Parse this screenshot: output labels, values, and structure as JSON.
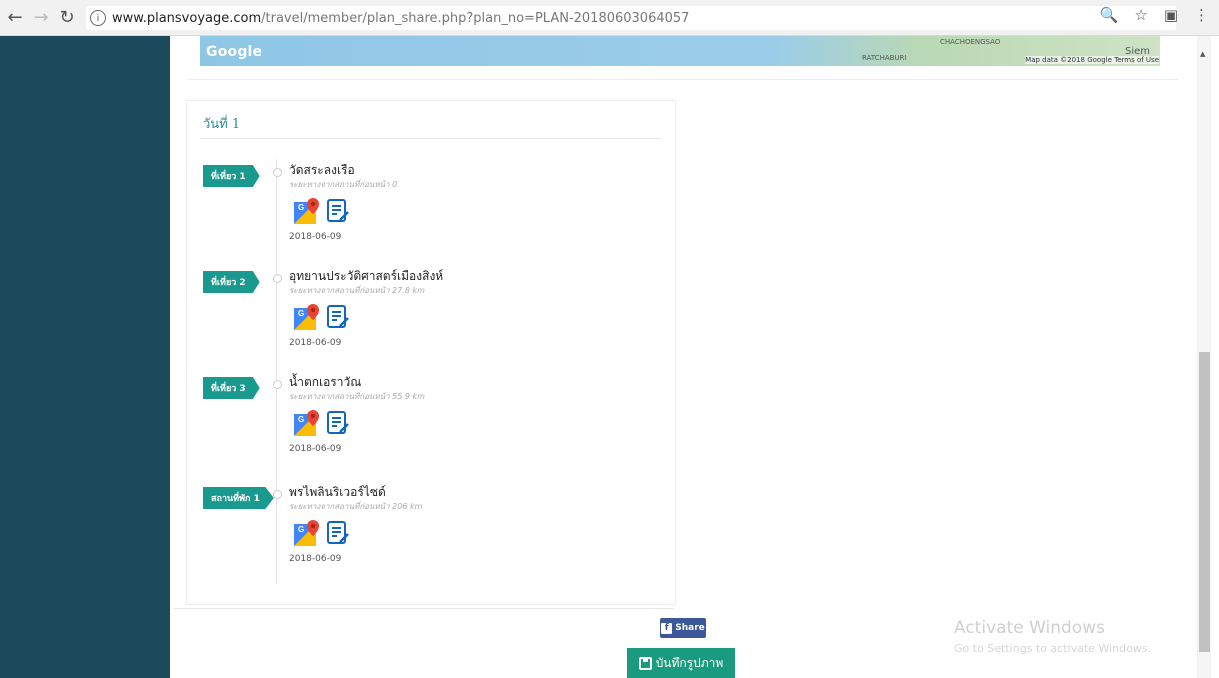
{
  "browser": {
    "back_icon": "arrow-left-icon",
    "forward_icon": "arrow-right-icon",
    "reload_icon": "reload-icon",
    "url_host": "www.plansvoyage.com",
    "url_path": "/travel/member/plan_share.php?plan_no=PLAN-20180603064057",
    "zoom_icon": "zoom-icon",
    "bookmark_icon": "star-icon",
    "extension_icon": "extension-icon",
    "menu_icon": "kebab-menu-icon"
  },
  "map": {
    "google_logo": "Google",
    "label_left": "RATCHABURI",
    "label_right": "CHACHOENGSAO",
    "label_far": "Siem",
    "attribution": "Map data ©2018 Google  Terms of Use"
  },
  "day": {
    "title": "วันที่ 1",
    "stops": [
      {
        "badge": "ที่เที่ยว 1",
        "name": "วัดสระลงเรือ",
        "note": "ระยะทางจากสถานที่ก่อนหน้า 0",
        "date": "2018-06-09"
      },
      {
        "badge": "ที่เที่ยว 2",
        "name": "อุทยานประวัติศาสตร์เมืองสิงห์",
        "note": "ระยะทางจากสถานที่ก่อนหน้า 27.8 km",
        "date": "2018-06-09"
      },
      {
        "badge": "ที่เที่ยว 3",
        "name": "น้ำตกเอราวัณ",
        "note": "ระยะทางจากสถานที่ก่อนหน้า 55.9 km",
        "date": "2018-06-09"
      },
      {
        "badge": "สถานที่พัก 1",
        "name": "พรไพลินริเวอร์ไซด์",
        "note": "ระยะทางจากสถานที่ก่อนหน้า 206 km",
        "date": "2018-06-09"
      }
    ]
  },
  "actions": {
    "share_label": "Share",
    "save_label": "บันทึกรูปภาพ"
  },
  "watermark": {
    "title": "Activate Windows",
    "subtitle": "Go to Settings to activate Windows."
  }
}
